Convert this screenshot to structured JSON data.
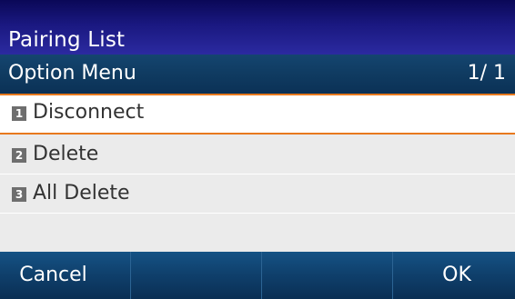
{
  "header": {
    "title": "Pairing List"
  },
  "menu": {
    "title": "Option Menu",
    "page_indicator": "1/ 1",
    "items": [
      {
        "number": "1",
        "label": "Disconnect",
        "selected": true
      },
      {
        "number": "2",
        "label": "Delete",
        "selected": false
      },
      {
        "number": "3",
        "label": "All Delete",
        "selected": false
      }
    ]
  },
  "softkeys": {
    "key1": "Cancel",
    "key2": "",
    "key3": "",
    "key4": "OK"
  },
  "colors": {
    "header_bg": "#1a1880",
    "menu_bar_bg": "#0f3a60",
    "selection_border": "#e8791e",
    "list_bg": "#ebebeb",
    "softkey_bg": "#0f3f6b"
  }
}
